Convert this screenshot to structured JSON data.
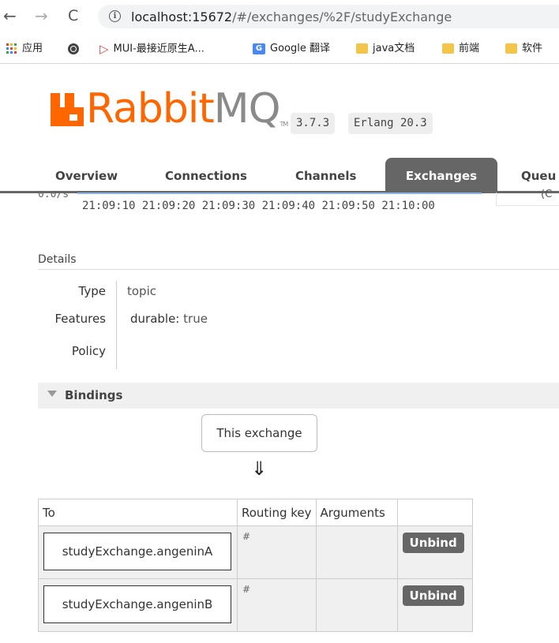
{
  "browser": {
    "back_glyph": "←",
    "forward_glyph": "→",
    "reload_glyph": "C",
    "url_host": "localhost:15672",
    "url_path": "/#/exchanges/%2F/studyExchange",
    "bookmarks": [
      {
        "label": "应用",
        "icon": "apps-icon"
      },
      {
        "label": "",
        "icon": "globe-icon"
      },
      {
        "label": "MUI-最接近原生A...",
        "icon": "play-icon"
      },
      {
        "label": "Google 翻译",
        "icon": "google-translate-icon"
      },
      {
        "label": "java文档",
        "icon": "folder-icon"
      },
      {
        "label": "前端",
        "icon": "folder-icon"
      },
      {
        "label": "软件",
        "icon": "folder-icon"
      }
    ]
  },
  "header": {
    "logo_rabbit": "Rabbit",
    "logo_mq": "MQ",
    "logo_tm": "TM",
    "version": "3.7.3",
    "erlang": "Erlang 20.3"
  },
  "tabs": [
    "Overview",
    "Connections",
    "Channels",
    "Exchanges",
    "Queu"
  ],
  "active_tab": "Exchanges",
  "chart_stub": {
    "rate_label": "0.0/s",
    "x_ticks": [
      "21:09:10",
      "21:09:20",
      "21:09:30",
      "21:09:40",
      "21:09:50",
      "21:10:00"
    ],
    "legend_fragment": "(C"
  },
  "details": {
    "title": "Details",
    "type_label": "Type",
    "type_value": "topic",
    "features_label": "Features",
    "features_key": "durable:",
    "features_value": "true",
    "policy_label": "Policy"
  },
  "bindings": {
    "title": "Bindings",
    "this_exchange": "This exchange",
    "arrow": "⇓",
    "columns": [
      "To",
      "Routing key",
      "Arguments",
      ""
    ],
    "rows": [
      {
        "to": "studyExchange.angeninA",
        "routing_key": "#",
        "arguments": "",
        "action": "Unbind"
      },
      {
        "to": "studyExchange.angeninB",
        "routing_key": "#",
        "arguments": "",
        "action": "Unbind"
      }
    ]
  },
  "colors": {
    "brand_orange": "#ff6600",
    "tab_active": "#666666",
    "folder": "#f3c64a",
    "google": "#4a89f3"
  }
}
